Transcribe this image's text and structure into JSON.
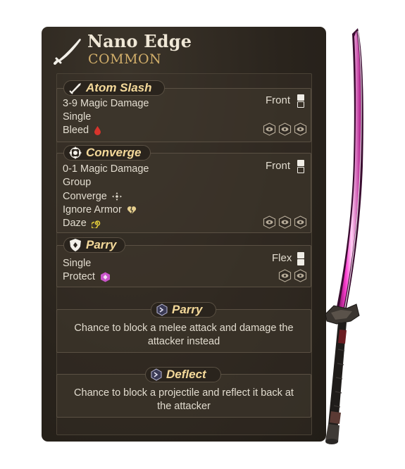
{
  "item": {
    "name": "Nano Edge",
    "rarity": "COMMON",
    "icon": "sword-icon"
  },
  "skills": [
    {
      "name": "Atom Slash",
      "icon": "slash-icon",
      "lines": [
        "3-9 Magic Damage",
        "Single",
        "Bleed"
      ],
      "position": "Front",
      "status_icons": [
        "bleed-icon"
      ]
    },
    {
      "name": "Converge",
      "icon": "converge-icon",
      "lines": [
        "0-1 Magic Damage",
        "Group",
        "Converge",
        "Ignore Armor",
        "Daze"
      ],
      "position": "Front",
      "status_icons": [
        "converge-icon",
        "broken-heart-icon",
        "daze-icon"
      ]
    },
    {
      "name": "Parry",
      "icon": "shield-icon",
      "lines": [
        "Single",
        "Protect"
      ],
      "position": "Flex",
      "status_icons": [
        "protect-icon"
      ]
    }
  ],
  "passives": [
    {
      "name": "Parry",
      "icon": "cube-icon",
      "description_lines": [
        "Chance to block a melee attack and damage the",
        "attacker instead"
      ]
    },
    {
      "name": "Deflect",
      "icon": "cube-icon",
      "description_lines": [
        "Chance to block a projectile and reflect it back at",
        "the attacker"
      ]
    }
  ],
  "colors": {
    "panel": "#2b261f",
    "title": "#efe7d6",
    "rarity": "#d1ae6a",
    "skill_name": "#f4d99a",
    "text": "#e2dccf",
    "blade": "#ff3fd2",
    "bleed": "#d8342c",
    "daze": "#e3cc3b",
    "protect": "#c955c9"
  }
}
